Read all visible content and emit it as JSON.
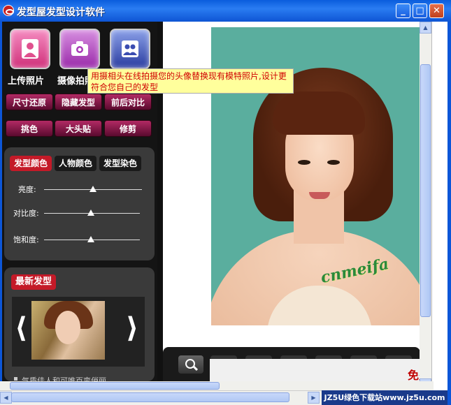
{
  "window": {
    "title": "发型屋发型设计软件",
    "minimize": "_",
    "maximize": "□",
    "close": "✕"
  },
  "sidebar": {
    "big_buttons": [
      {
        "label": "上传照片",
        "icon": "upload-photo-icon"
      },
      {
        "label": "摄像拍照",
        "icon": "camera-icon"
      },
      {
        "label": "",
        "icon": "people-icon"
      }
    ],
    "actions_row1": [
      "尺寸还原",
      "隐藏发型",
      "前后对比"
    ],
    "actions_row2": [
      "挑色",
      "大头贴",
      "修剪"
    ],
    "color_tabs": [
      "发型颜色",
      "人物颜色",
      "发型染色"
    ],
    "sliders": [
      {
        "label": "亮度:",
        "value": 0.5
      },
      {
        "label": "对比度:",
        "value": 0.5
      },
      {
        "label": "饱和度:",
        "value": 0.5
      }
    ],
    "new_styles_title": "最新发型",
    "prev_arrow": "⟨",
    "next_arrow": "⟩",
    "style_desc": "气质佳人和可唯百变俏丽"
  },
  "tooltip": "用摄相头在线拍摄您的头像替换现有模特照片,设计更符合您自己的发型",
  "photo": {
    "watermark": "cnmeifa"
  },
  "ad": {
    "text": "免费"
  },
  "site_banner": "JZ5U绿色下载站www.jz5u.com",
  "colors": {
    "accent": "#c41a28",
    "titlebar": "#0a5ddc",
    "panel": "#3a3a3a"
  }
}
